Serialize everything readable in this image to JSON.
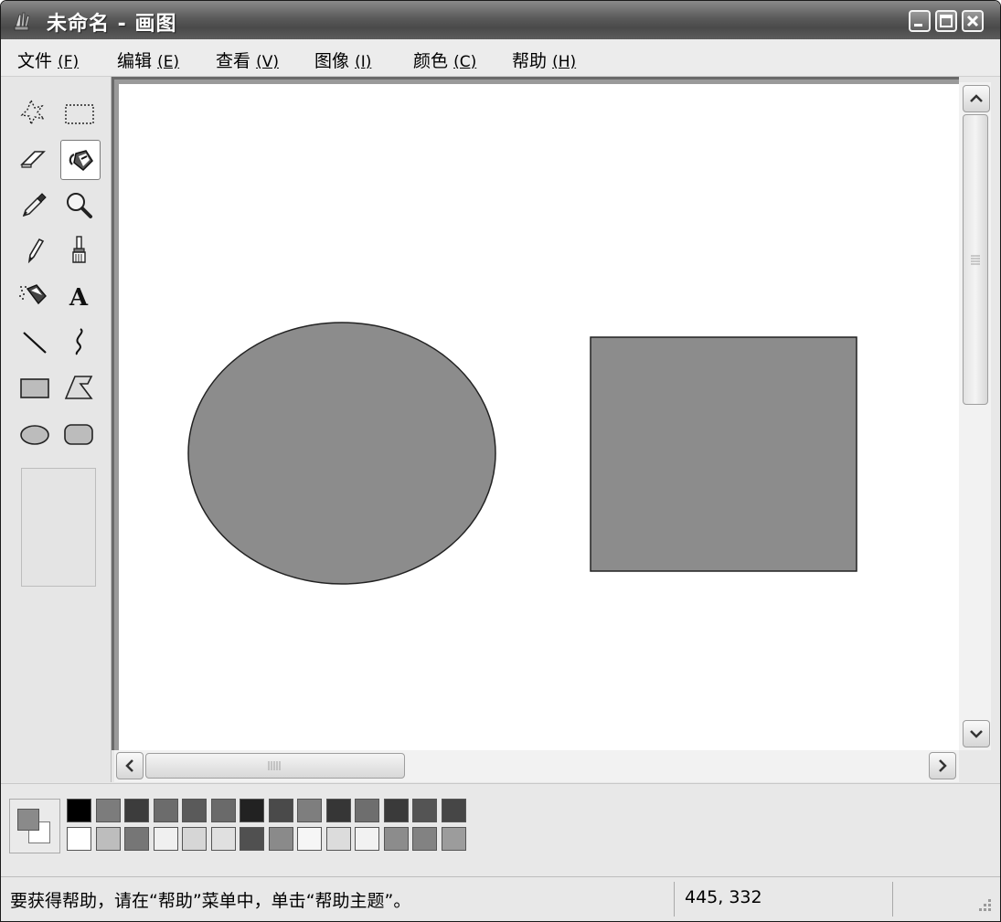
{
  "window": {
    "title": "未命名 - 画图"
  },
  "menu": {
    "items": [
      {
        "label": "文件",
        "accel": "(F)"
      },
      {
        "label": "编辑",
        "accel": "(E)"
      },
      {
        "label": "查看",
        "accel": "(V)"
      },
      {
        "label": "图像",
        "accel": "(I)"
      },
      {
        "label": "颜色",
        "accel": "(C)"
      },
      {
        "label": "帮助",
        "accel": "(H)"
      }
    ]
  },
  "toolbox": {
    "tools": [
      "free-form-select",
      "rectangle-select",
      "eraser",
      "fill-with-color",
      "pick-color",
      "magnifier",
      "pencil",
      "brush",
      "airbrush",
      "text",
      "line",
      "curve",
      "rectangle",
      "polygon",
      "ellipse",
      "rounded-rectangle"
    ],
    "selected": "fill-with-color",
    "text_tool_glyph": "A"
  },
  "canvas": {
    "shapes": [
      {
        "type": "ellipse",
        "fill": "#8c8c8c"
      },
      {
        "type": "rectangle",
        "fill": "#8c8c8c"
      }
    ]
  },
  "palette": {
    "foreground": "#8a8a8a",
    "background": "#ffffff",
    "row1": [
      "#000000",
      "#7c7c7c",
      "#3c3c3c",
      "#6c6c6c",
      "#5a5a5a",
      "#6a6a6a",
      "#222222",
      "#4a4a4a",
      "#7e7e7e",
      "#363636",
      "#6e6e6e",
      "#3a3a3a",
      "#545454",
      "#464646"
    ],
    "row2": [
      "#ffffff",
      "#bdbdbd",
      "#767676",
      "#f0f0f0",
      "#d6d6d6",
      "#e0e0e0",
      "#505050",
      "#8a8a8a",
      "#f6f6f6",
      "#dcdcdc",
      "#f2f2f2",
      "#8c8c8c",
      "#828282",
      "#9c9c9c"
    ]
  },
  "status": {
    "help_text": "要获得帮助，请在“帮助”菜单中，单击“帮助主题”。",
    "coords": "445, 332"
  }
}
